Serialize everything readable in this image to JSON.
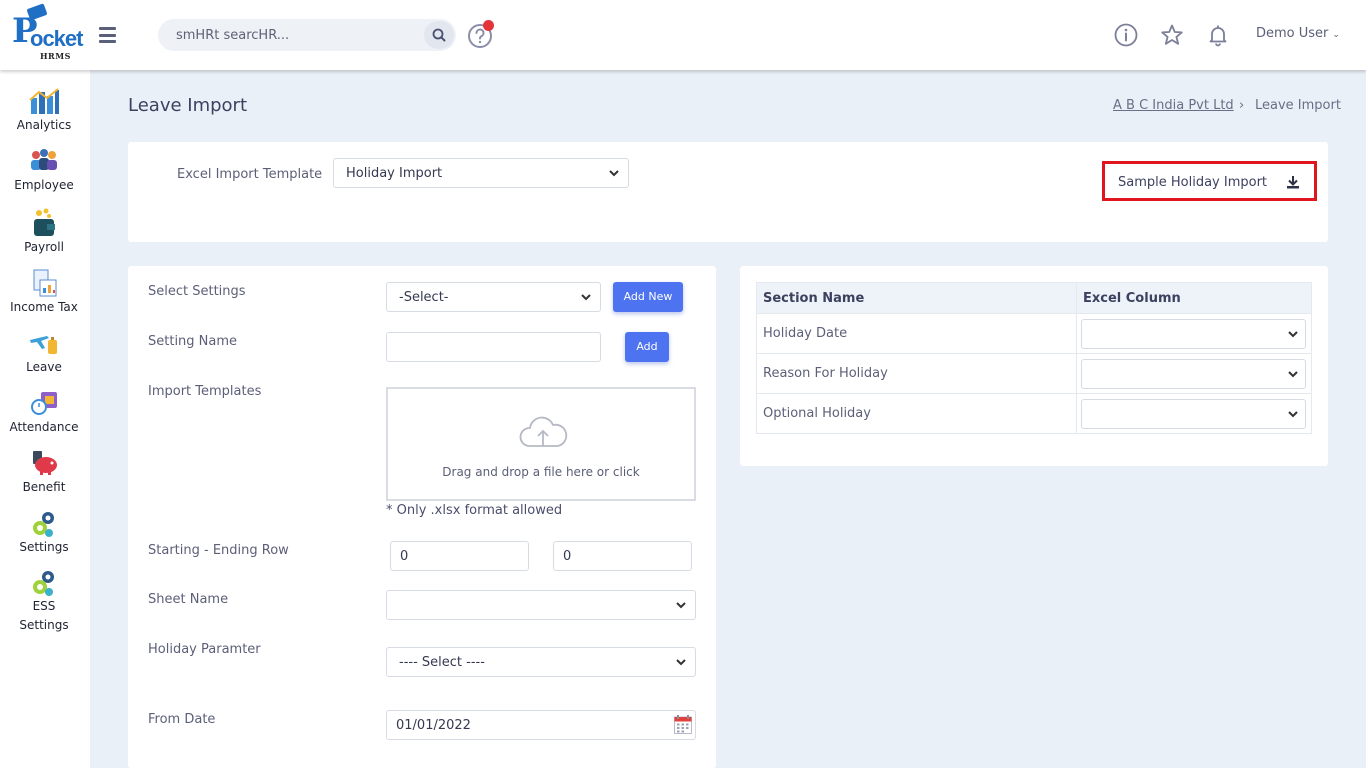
{
  "brand": {
    "logo_p": "P",
    "logo_rest": "ocket",
    "logo_sub": "HRMS"
  },
  "search": {
    "placeholder": "smHRt searcHR..."
  },
  "user": {
    "name": "Demo User"
  },
  "sidebar": {
    "items": [
      {
        "label": "Analytics",
        "icon": "analytics-icon"
      },
      {
        "label": "Employee",
        "icon": "employee-icon"
      },
      {
        "label": "Payroll",
        "icon": "payroll-icon"
      },
      {
        "label": "Income Tax",
        "icon": "income-tax-icon"
      },
      {
        "label": "Leave",
        "icon": "leave-icon"
      },
      {
        "label": "Attendance",
        "icon": "attendance-icon"
      },
      {
        "label": "Benefit",
        "icon": "benefit-icon"
      },
      {
        "label": "Settings",
        "icon": "settings-icon"
      },
      {
        "label": "ESS",
        "label2": "Settings",
        "icon": "ess-settings-icon"
      }
    ]
  },
  "page": {
    "title": "Leave Import",
    "breadcrumb": {
      "company": "A B C India Pvt Ltd",
      "separator": "›",
      "current": "Leave Import"
    }
  },
  "template_card": {
    "label": "Excel Import Template",
    "selected": "Holiday Import",
    "sample_button": "Sample Holiday Import"
  },
  "form": {
    "select_settings": {
      "label": "Select Settings",
      "value": "-Select-",
      "add_new": "Add New"
    },
    "setting_name": {
      "label": "Setting Name",
      "value": "",
      "add": "Add"
    },
    "import_templates": {
      "label": "Import Templates",
      "drop_text": "Drag and drop a file here or click",
      "note": "* Only .xlsx format allowed"
    },
    "row_range": {
      "label": "Starting - Ending Row",
      "start": "0",
      "end": "0"
    },
    "sheet_name": {
      "label": "Sheet Name",
      "value": ""
    },
    "holiday_param": {
      "label": "Holiday Paramter",
      "value": "---- Select ----"
    },
    "from_date": {
      "label": "From Date",
      "value": "01/01/2022"
    }
  },
  "mapping": {
    "headers": [
      "Section Name",
      "Excel Column"
    ],
    "rows": [
      {
        "section": "Holiday Date",
        "column": ""
      },
      {
        "section": "Reason For Holiday",
        "column": ""
      },
      {
        "section": "Optional Holiday",
        "column": ""
      }
    ]
  },
  "colors": {
    "primary": "#4e73f0",
    "highlight": "#e0161f",
    "background": "#eaf0f7"
  }
}
